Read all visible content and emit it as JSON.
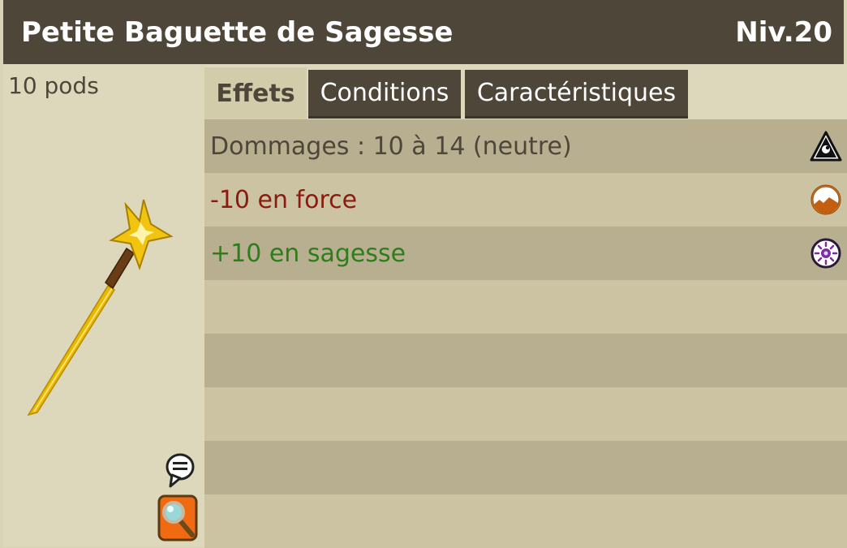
{
  "item": {
    "name": "Petite Baguette de Sagesse",
    "level": "Niv.20",
    "weight": "10 pods",
    "image": "star-wand-icon"
  },
  "tabs": [
    {
      "label": "Effets",
      "active": true
    },
    {
      "label": "Conditions",
      "active": false
    },
    {
      "label": "Caractéristiques",
      "active": false
    }
  ],
  "effects": [
    {
      "text": "Dommages : 10 à 14 (neutre)",
      "color": "#4f463a",
      "icon": "neutral-element-icon"
    },
    {
      "text": "-10 en force",
      "color": "#8b1a10",
      "icon": "strength-icon"
    },
    {
      "text": "+10 en sagesse",
      "color": "#2e7d1b",
      "icon": "wisdom-icon"
    }
  ],
  "actions": {
    "chat_icon": "speech-bubble-icon",
    "inspect_icon": "magnifier-icon"
  },
  "colors": {
    "header_bg": "#4f463a",
    "panel_bg": "#ddd8bb",
    "row_dark": "#b8af90",
    "row_light": "#cbc3a2",
    "inspect_button": "#f06a12"
  }
}
